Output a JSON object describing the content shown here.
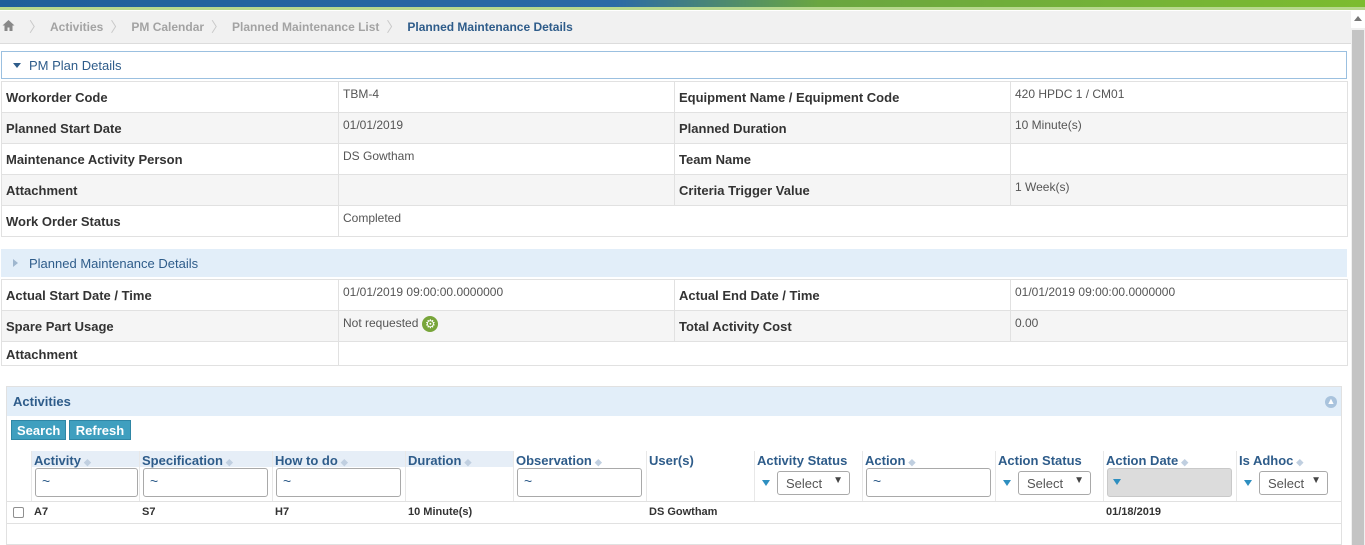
{
  "breadcrumb": {
    "home_icon": "home-icon",
    "items": [
      "Activities",
      "PM Calendar",
      "Planned Maintenance List",
      "Planned Maintenance Details"
    ]
  },
  "pm_plan": {
    "title": "PM Plan Details",
    "rows": [
      {
        "l1": "Workorder Code",
        "v1": "TBM-4",
        "l2": "Equipment Name / Equipment Code",
        "v2": "420 HPDC 1 / CM01"
      },
      {
        "l1": "Planned Start Date",
        "v1": "01/01/2019",
        "l2": "Planned Duration",
        "v2": "10 Minute(s)"
      },
      {
        "l1": "Maintenance Activity Person",
        "v1": "DS Gowtham",
        "l2": "Team Name",
        "v2": ""
      },
      {
        "l1": "Attachment",
        "v1": "",
        "l2": "Criteria Trigger Value",
        "v2": "1 Week(s)"
      },
      {
        "l1": "Work Order Status",
        "v1": "Completed"
      }
    ]
  },
  "pm_details": {
    "title": "Planned Maintenance Details",
    "rows": [
      {
        "l1": "Actual Start Date / Time",
        "v1": "01/01/2019 09:00:00.0000000",
        "l2": "Actual End Date / Time",
        "v2": "01/01/2019 09:00:00.0000000"
      },
      {
        "l1": "Spare Part Usage",
        "v1": "Not requested",
        "l2": "Total Activity Cost",
        "v2": "0.00"
      },
      {
        "l1": "Attachment",
        "v1": ""
      }
    ]
  },
  "activities": {
    "title": "Activities",
    "search_label": "Search",
    "refresh_label": "Refresh",
    "columns": {
      "activity": "Activity",
      "specification": "Specification",
      "how_to_do": "How to do",
      "duration": "Duration",
      "observation": "Observation",
      "users": "User(s)",
      "activity_status": "Activity Status",
      "action": "Action",
      "action_status": "Action Status",
      "action_date": "Action Date",
      "is_adhoc": "Is Adhoc"
    },
    "filter_placeholder": "~",
    "select_label": "Select",
    "row": {
      "activity": "A7",
      "specification": "S7",
      "how_to_do": "H7",
      "duration": "10 Minute(s)",
      "observation": "",
      "users": "DS Gowtham",
      "activity_status": "",
      "action": "",
      "action_status": "",
      "action_date": "01/18/2019",
      "is_adhoc": ""
    }
  }
}
